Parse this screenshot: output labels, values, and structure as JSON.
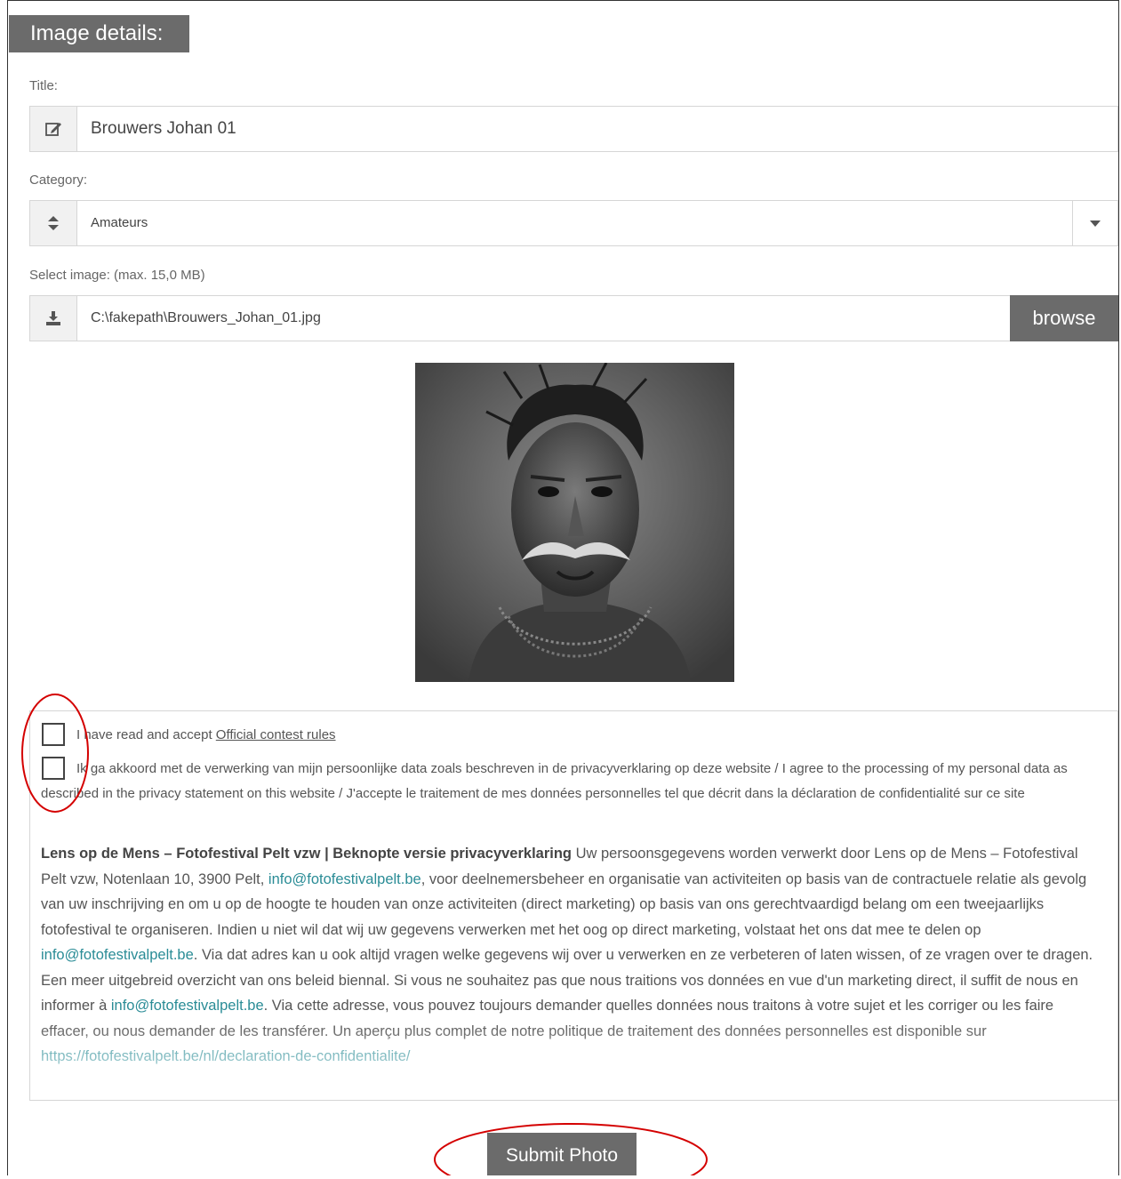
{
  "section": {
    "heading": "Image details:"
  },
  "title_field": {
    "label": "Title:",
    "value": "Brouwers Johan 01",
    "icon": "edit-icon"
  },
  "category_field": {
    "label": "Category:",
    "value": "Amateurs",
    "icon": "sort-icon",
    "dropdown_icon": "caret-down-icon"
  },
  "image_field": {
    "label": "Select image: (max. 15,0 MB)",
    "value": "C:\\fakepath\\Brouwers_Johan_01.jpg",
    "icon": "download-icon",
    "browse_label": "browse"
  },
  "consent": {
    "rules_prefix": "I have read and accept ",
    "rules_link": "Official contest rules",
    "privacy_agree": "Ik ga akkoord met de verwerking van mijn persoonlijke data zoals beschreven in de privacyverklaring op deze website / I agree to the processing of my personal data as described in the privacy statement on this website / J'accepte le traitement de mes données personnelles tel que décrit dans la déclaration de confidentialité sur ce site",
    "privacy_heading": "Lens op de Mens – Fotofestival Pelt vzw | Beknopte versie privacyverklaring",
    "privacy_p1": " Uw persoonsgegevens worden verwerkt door Lens op de Mens – Fotofestival Pelt vzw, Notenlaan 10, 3900 Pelt, ",
    "email": "info@fotofestivalpelt.be",
    "privacy_p2": ", voor deelnemersbeheer en organisatie van activiteiten op basis van de contractuele relatie als gevolg van uw inschrijving en om u op de hoogte te houden van onze activiteiten (direct marketing) op basis van ons gerechtvaardigd belang om een tweejaarlijks fotofestival te organiseren. Indien u niet wil dat wij uw gegevens verwerken met het oog op direct marketing, volstaat het ons dat mee te delen op ",
    "privacy_p3": ". Via dat adres kan u ook altijd vragen welke gegevens wij over u verwerken en ze verbeteren of laten wissen, of ze vragen over te dragen. Een meer uitgebreid overzicht van ons beleid biennal. Si vous ne souhaitez pas que nous traitions vos données en vue d'un marketing direct, il suffit de nous en informer à ",
    "privacy_p4": ". Via cette adresse, vous pouvez toujours demander quelles données nous traitons à votre sujet et les corriger ou les faire effacer, ou nous demander de les transférer. Un aperçu plus complet de notre politique de traitement des données personnelles est disponible sur ",
    "privacy_url": "https://fotofestivalpelt.be/nl/declaration-de-confidentialite/"
  },
  "submit": {
    "label": "Submit Photo"
  },
  "colors": {
    "accent": "#6b6b6b",
    "link": "#2a8c96",
    "annotation": "#d40000"
  }
}
